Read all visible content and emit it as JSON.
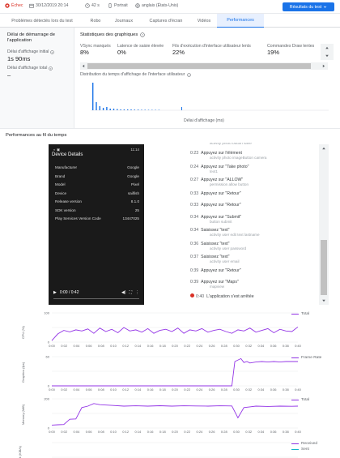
{
  "header": {
    "status": "Échec",
    "date": "30/12/2019 20:14",
    "duration": "42 s",
    "orientation": "Portrait",
    "locale": "anglais (États-Unis)",
    "results_button": "Résultats du test"
  },
  "tabs": [
    {
      "label": "Problèmes détectés lors du test",
      "active": false
    },
    {
      "label": "Robo",
      "active": false
    },
    {
      "label": "Journaux",
      "active": false
    },
    {
      "label": "Captures d'écran",
      "active": false
    },
    {
      "label": "Vidéos",
      "active": false
    },
    {
      "label": "Performances",
      "active": true
    }
  ],
  "startup": {
    "title": "Délai de démarrage de l'application",
    "initial_label": "Délai d'affichage initial",
    "initial_value": "1s 90ms",
    "total_label": "Délai d'affichage total",
    "total_value": "–"
  },
  "graphics": {
    "title": "Statistiques des graphiques",
    "stats": [
      {
        "label": "VSync manqués",
        "value": "8%"
      },
      {
        "label": "Latence de saisie élevée",
        "value": "0%"
      },
      {
        "label": "Fils d'exécution d'interface utilisateur lents",
        "value": "22%"
      },
      {
        "label": "Commandes Draw lentes",
        "value": "19%"
      }
    ],
    "distribution_title": "Distribution du temps d'affichage de l'interface utilisateur",
    "xlabel": "Délai d'affichage (ms)"
  },
  "performance": {
    "title": "Performances au fil du temps"
  },
  "device_screen": {
    "title": "Device Details",
    "rows": [
      {
        "k": "Manufacturer",
        "v": "Google"
      },
      {
        "k": "Brand",
        "v": "Google"
      },
      {
        "k": "Model",
        "v": "Pixel"
      },
      {
        "k": "Device",
        "v": "sailfish"
      },
      {
        "k": "Release version",
        "v": "8.1.0"
      },
      {
        "k": "SDK version",
        "v": "25"
      },
      {
        "k": "Play Services Version Code",
        "v": "13447025"
      }
    ],
    "time": "0:00 / 0:42",
    "statusbar_time": "11:14"
  },
  "log": [
    {
      "time": "",
      "text": "",
      "sub": "activity  photo  button  save"
    },
    {
      "time": "0:23",
      "text": "Appuyez sur l'élément",
      "sub": "activity  photo  imageButton  camera"
    },
    {
      "time": "0:24",
      "text": "Appuyez sur \"Take photo\"",
      "sub": "text1"
    },
    {
      "time": "0:27",
      "text": "Appuyez sur \"ALLOW\"",
      "sub": "permission  allow  button"
    },
    {
      "time": "0:33",
      "text": "Appuyez sur \"Retour\"",
      "sub": ""
    },
    {
      "time": "0:33",
      "text": "Appuyez sur \"Retour\"",
      "sub": ""
    },
    {
      "time": "0:34",
      "text": "Appuyez sur \"Submit\"",
      "sub": "button  submit"
    },
    {
      "time": "0:34",
      "text": "Saisissez \"text\"",
      "sub": "activity  user  edit  text  lastname"
    },
    {
      "time": "0:36",
      "text": "Saisissez \"text\"",
      "sub": "activity  user  password"
    },
    {
      "time": "0:37",
      "text": "Saisissez \"text\"",
      "sub": "activity  user  email"
    },
    {
      "time": "0:39",
      "text": "Appuyez sur \"Retour\"",
      "sub": ""
    },
    {
      "time": "0:39",
      "text": "Appuyez sur \"Maps\"",
      "sub": "mapview"
    },
    {
      "time": "0:40",
      "text": "L'application s'est arrêtée",
      "sub": ""
    }
  ],
  "charts": [
    {
      "ylabel": "CPU (%)",
      "legend": [
        "Total"
      ],
      "colors": [
        "#9334e6"
      ]
    },
    {
      "ylabel": "Graphics (fps)",
      "legend": [
        "Frame Rate"
      ],
      "colors": [
        "#9334e6"
      ]
    },
    {
      "ylabel": "Memory (MiB)",
      "legend": [
        "Total"
      ],
      "colors": [
        "#9334e6"
      ]
    },
    {
      "ylabel": "Network (KiB/s)",
      "legend": [
        "Received",
        "Sent"
      ],
      "colors": [
        "#9334e6",
        "#12b5cb"
      ]
    }
  ],
  "time_ticks": [
    "0:00",
    "0:02",
    "0:04",
    "0:06",
    "0:08",
    "0:10",
    "0:12",
    "0:14",
    "0:16",
    "0:18",
    "0:20",
    "0:22",
    "0:24",
    "0:26",
    "0:28",
    "0:30",
    "0:32",
    "0:34",
    "0:36",
    "0:38",
    "0:40"
  ],
  "chart_data": [
    {
      "type": "line",
      "title": "",
      "ylabel": "CPU (%)",
      "ylim": [
        0,
        100
      ],
      "x": [
        0,
        1,
        2,
        3,
        4,
        5,
        6,
        7,
        8,
        9,
        10,
        11,
        12,
        13,
        14,
        15,
        16,
        17,
        18,
        19,
        20,
        21,
        22,
        23,
        24,
        25,
        26,
        27,
        28,
        29,
        30,
        31,
        32,
        33,
        34,
        35,
        36,
        37,
        38,
        39,
        40,
        41
      ],
      "series": [
        {
          "name": "Total",
          "values": [
            5,
            28,
            40,
            35,
            42,
            38,
            45,
            30,
            48,
            36,
            44,
            32,
            50,
            38,
            42,
            34,
            46,
            30,
            40,
            44,
            36,
            48,
            30,
            42,
            38,
            46,
            34,
            40,
            44,
            36,
            30,
            42,
            38,
            48,
            34,
            40,
            46,
            32,
            44,
            38,
            36,
            52
          ]
        }
      ]
    },
    {
      "type": "line",
      "title": "",
      "ylabel": "Graphics (fps)",
      "ylim": [
        0,
        60
      ],
      "x": [
        0,
        30,
        30.5,
        31.5,
        32,
        32.5,
        33,
        34,
        35,
        36,
        37,
        38,
        39,
        40,
        41
      ],
      "series": [
        {
          "name": "Frame Rate",
          "values": [
            0,
            0,
            50,
            56,
            48,
            50,
            47,
            49,
            50,
            49,
            50,
            49,
            50,
            50,
            50
          ]
        }
      ]
    },
    {
      "type": "line",
      "title": "",
      "ylabel": "Memory (MiB)",
      "ylim": [
        0,
        200
      ],
      "x": [
        0,
        1,
        2,
        3,
        4,
        5,
        6,
        7,
        8,
        10,
        12,
        14,
        16,
        18,
        20,
        22,
        24,
        26,
        28,
        30,
        31,
        32,
        33,
        34,
        36,
        38,
        40,
        41
      ],
      "series": [
        {
          "name": "Total",
          "values": [
            20,
            22,
            24,
            60,
            62,
            140,
            150,
            168,
            160,
            155,
            150,
            152,
            150,
            153,
            150,
            152,
            151,
            150,
            152,
            151,
            70,
            140,
            145,
            150,
            148,
            150,
            149,
            150
          ]
        }
      ]
    }
  ]
}
